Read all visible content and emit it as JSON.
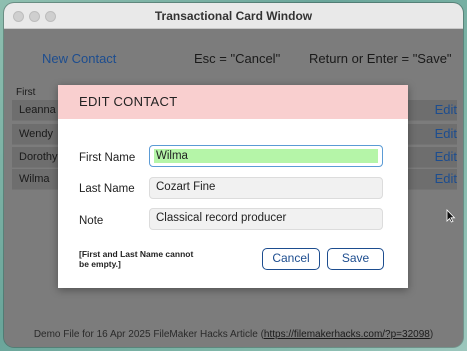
{
  "window": {
    "title": "Transactional Card Window"
  },
  "toolbar": {
    "new_contact": "New Contact",
    "esc_hint": "Esc = \"Cancel\"",
    "return_hint": "Return or Enter = \"Save\""
  },
  "list": {
    "column_first": "First",
    "rows": [
      {
        "name": "Leanna",
        "edit": "Edit"
      },
      {
        "name": "Wendy",
        "edit": "Edit"
      },
      {
        "name": "Dorothy",
        "edit": "Edit"
      },
      {
        "name": "Wilma",
        "edit": "Edit"
      }
    ]
  },
  "modal": {
    "title": "EDIT CONTACT",
    "first_name_label": "First Name",
    "first_name_value": "Wilma",
    "last_name_label": "Last Name",
    "last_name_value": "Cozart Fine",
    "note_label": "Note",
    "note_value": "Classical record producer",
    "warning_line1": "[First and Last Name cannot",
    "warning_line2": "be empty.]",
    "cancel_label": "Cancel",
    "save_label": "Save"
  },
  "footer": {
    "text": "Demo File for 16 Apr 2025 FileMaker Hacks Article (",
    "link": "https://filemakerhacks.com/?p=32098",
    "close": ")"
  },
  "colors": {
    "accent": "#1d4d8f",
    "modal_header": "#f9cfcf",
    "field_highlight": "#b5f5a8"
  }
}
